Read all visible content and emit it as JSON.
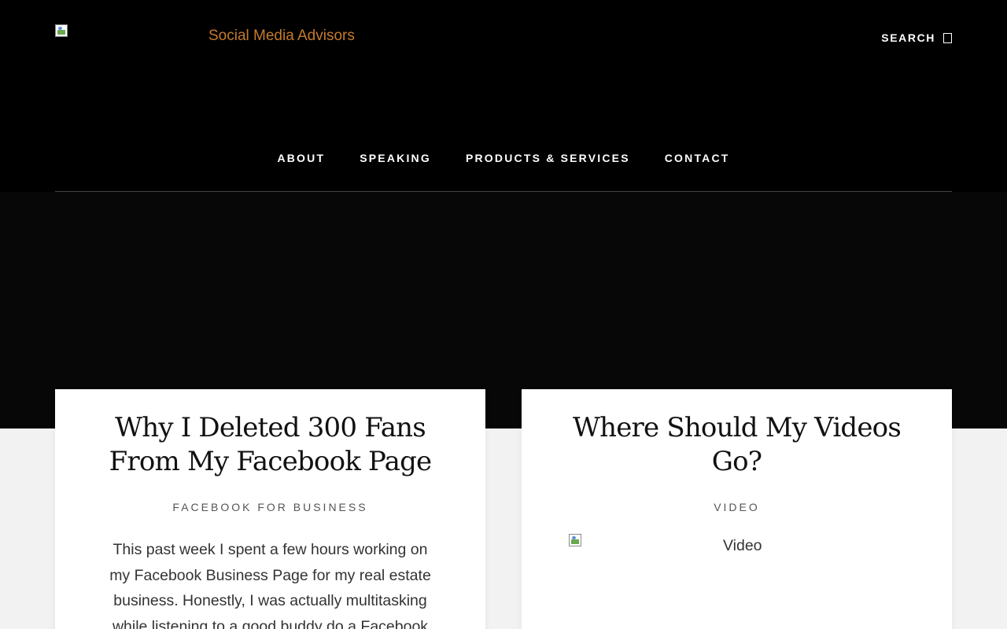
{
  "header": {
    "site_title": "Social Media Advisors",
    "search_label": "SEARCH",
    "nav": [
      {
        "label": "ABOUT"
      },
      {
        "label": "SPEAKING"
      },
      {
        "label": "PRODUCTS & SERVICES"
      },
      {
        "label": "CONTACT"
      }
    ]
  },
  "posts": [
    {
      "title": "Why I Deleted 300 Fans From My Facebook Page",
      "category": "FACEBOOK FOR BUSINESS",
      "excerpt": "This past week I spent a few hours working on my Facebook Business Page for my real estate business.  Honestly, I was actually multitasking while listening to a good buddy do a Facebook"
    },
    {
      "title": "Where Should My Videos Go?",
      "category": "VIDEO",
      "image_alt": "Video"
    }
  ],
  "colors": {
    "site_title": "#c47a2c",
    "header_bg": "#000000",
    "hero_bg": "#070707",
    "page_bg": "#f2f2f2"
  },
  "icons": {
    "search": "search-icon",
    "broken_image": "broken-image-icon"
  }
}
